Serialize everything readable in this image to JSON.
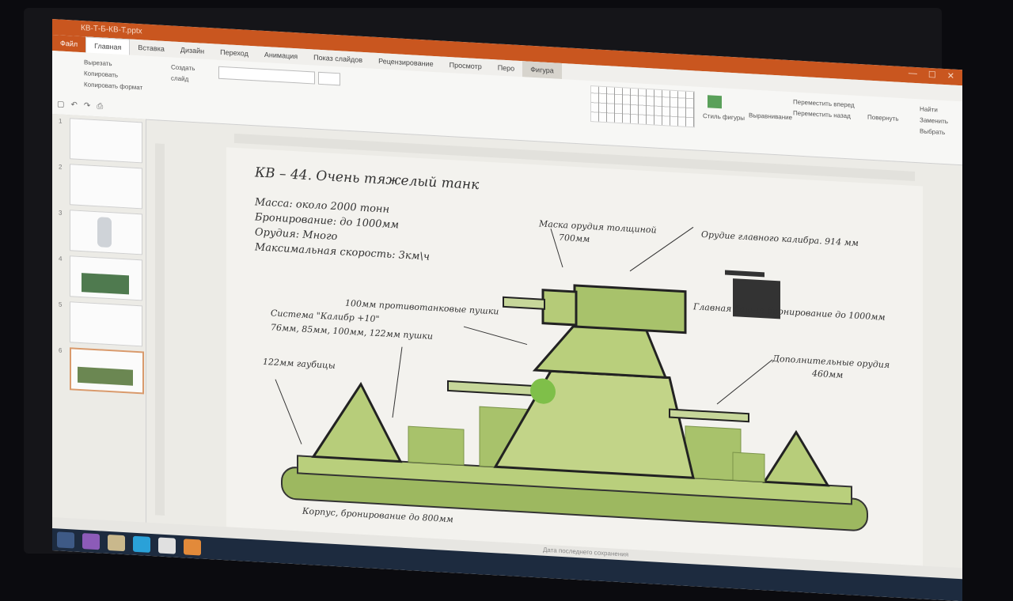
{
  "window": {
    "title": "КВ-Т-Б-КВ-Т.pptx",
    "account": ""
  },
  "tabs": [
    "Файл",
    "Главная",
    "Вставка",
    "Дизайн",
    "Переход",
    "Анимация",
    "Показ слайдов",
    "Рецензирование",
    "Просмотр",
    "Перо",
    "Фигура"
  ],
  "ribbon": {
    "clipboard": {
      "cut": "Вырезать",
      "copy": "Копировать",
      "format": "Копировать формат"
    },
    "slides": {
      "new": "Создать слайд"
    },
    "shape_style": "Стиль фигуры",
    "arrange": "Выравнивание",
    "forward": "Переместить вперед",
    "backward": "Переместить назад",
    "group": "Повернуть",
    "find": "Найти",
    "replace": "Заменить",
    "select": "Выбрать"
  },
  "thumbnails": [
    {
      "n": "1"
    },
    {
      "n": "2"
    },
    {
      "n": "3"
    },
    {
      "n": "4"
    },
    {
      "n": "5"
    },
    {
      "n": "6"
    }
  ],
  "slide": {
    "title": "КВ – 44. Очень тяжелый танк",
    "info": [
      "Масса: около 2000 тонн",
      "Бронирование: до 1000мм",
      "Орудия: Много",
      "Максимальная скорость: 3км\\ч"
    ],
    "labels": {
      "mask": "Маска орудия толщиной",
      "mask_val": "700мм",
      "main_gun": "Орудие главного калибра. 914 мм",
      "main_armor": "Главная башня бронирование до 1000мм",
      "at_guns": "100мм противотанковые пушки",
      "system": "Система \"Калибр +10\"",
      "system_sub": "76мм, 85мм, 100мм, 122мм пушки",
      "howitzers": "122мм гаубицы",
      "extra": "Дополнительные орудия",
      "extra_val": "460мм",
      "hull": "Корпус, бронирование до 800мм"
    }
  },
  "taskbar": {
    "status": "Дата последнего сохранения"
  },
  "colors": {
    "accent": "#c9561f",
    "tank": "#a9c46a",
    "tank_dark": "#6f8f3a"
  }
}
